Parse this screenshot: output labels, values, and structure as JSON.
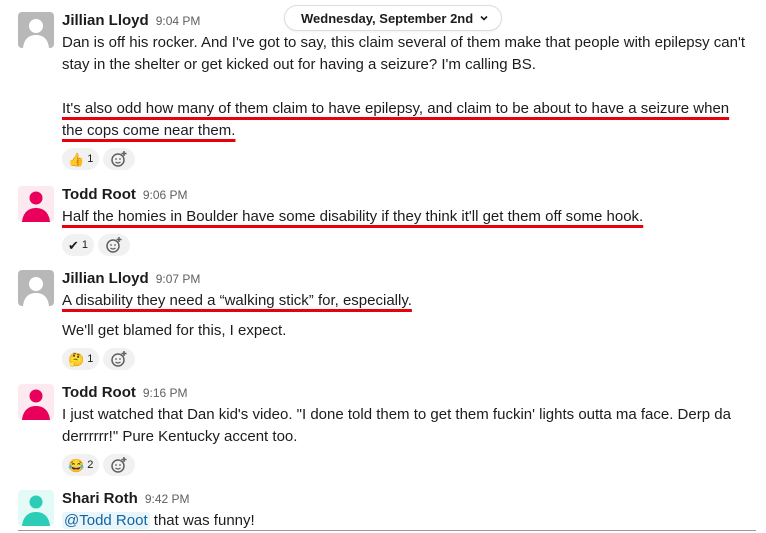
{
  "date_pill": {
    "label": "Wednesday, September 2nd"
  },
  "colors": {
    "underline": "#e8000b",
    "todd_avatar": "#e8005a",
    "shari_avatar": "#2bcdb7",
    "mention_bg": "#e8f5fa",
    "mention_fg": "#1264a3"
  },
  "messages": [
    {
      "name": "Jillian Lloyd",
      "time": "9:04 PM",
      "avatar_icon": "default-user-icon",
      "paragraph1": "Dan is off his rocker. And I've got to say, this claim several of them make that people with epilepsy can't stay in the shelter or get kicked out for having a seizure? I'm calling BS.",
      "paragraph2": "It's also odd how many of them claim to have epilepsy, and claim to be about to have a seizure when the cops come near them.",
      "reaction": {
        "emoji": "👍",
        "count": "1",
        "icon": "thumbs-up-icon"
      }
    },
    {
      "name": "Todd Root",
      "time": "9:06 PM",
      "avatar_icon": "person-icon",
      "paragraph1": "Half the homies in Boulder have some disability if they think it'll get them off some hook.",
      "reaction": {
        "emoji": "✔",
        "count": "1",
        "icon": "checkmark-icon"
      }
    },
    {
      "name": "Jillian Lloyd",
      "time": "9:07 PM",
      "avatar_icon": "default-user-icon",
      "paragraph1": "A disability they need a “walking stick” for, especially.",
      "paragraph2": "We'll get blamed for this, I expect.",
      "reaction": {
        "emoji": "🤔",
        "count": "1",
        "icon": "thinking-face-icon"
      }
    },
    {
      "name": "Todd Root",
      "time": "9:16 PM",
      "avatar_icon": "person-icon",
      "paragraph1": "I just watched that Dan kid's video. \"I done told them to get them fuckin' lights outta ma  face. Derp da derrrrrr!\" Pure Kentucky accent too.",
      "reaction": {
        "emoji": "😂",
        "count": "2",
        "icon": "laughing-face-icon"
      }
    },
    {
      "name": "Shari Roth",
      "time": "9:42 PM",
      "avatar_icon": "person-icon",
      "mention": "@Todd Root",
      "paragraph1": " that was funny!"
    }
  ]
}
